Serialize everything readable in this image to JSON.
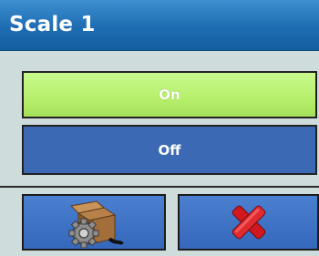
{
  "window": {
    "title": "Scale 1"
  },
  "options": {
    "on_label": "On",
    "off_label": "Off",
    "selected": "On"
  },
  "footer": {
    "left_icon": "setup-box-gear-icon",
    "right_icon": "cancel-x-icon"
  },
  "colors": {
    "title_bar": "#1e6db3",
    "selected_option": "#b8f06e",
    "unselected_option": "#3b69b3",
    "background": "#cfdcdc",
    "cancel_red": "#d0181e"
  }
}
